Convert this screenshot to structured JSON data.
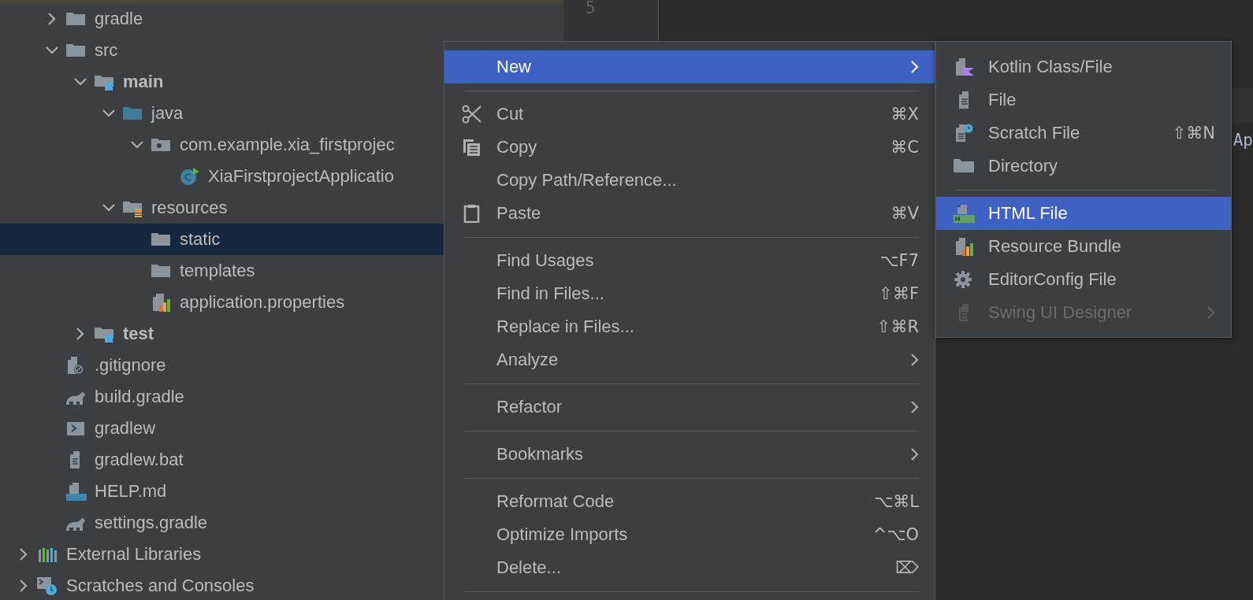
{
  "project_tree": {
    "project_items": [
      {
        "label": "gradle",
        "kind": "folder",
        "expanded": false,
        "selected": false
      },
      {
        "label": "src",
        "kind": "folder",
        "expanded": true,
        "selected": false,
        "children": [
          {
            "label": "main",
            "kind": "source-root",
            "expanded": true,
            "selected": false,
            "children": [
              {
                "label": "java",
                "kind": "java-root",
                "expanded": true,
                "selected": false,
                "children": [
                  {
                    "label": "com.example.xia_firstprojec",
                    "kind": "package",
                    "expanded": true,
                    "selected": false,
                    "children": [
                      {
                        "label": "XiaFirstprojectApplicatio",
                        "kind": "spring-class",
                        "selected": false
                      }
                    ]
                  }
                ]
              },
              {
                "label": "resources",
                "kind": "resources-root",
                "expanded": true,
                "selected": false,
                "children": [
                  {
                    "label": "static",
                    "kind": "folder",
                    "selected": true
                  },
                  {
                    "label": "templates",
                    "kind": "folder",
                    "selected": false
                  },
                  {
                    "label": "application.properties",
                    "kind": "properties",
                    "selected": false
                  }
                ]
              }
            ]
          },
          {
            "label": "test",
            "kind": "source-root",
            "expanded": false,
            "selected": false
          }
        ]
      },
      {
        "label": ".gitignore",
        "kind": "ignore-file",
        "selected": false
      },
      {
        "label": "build.gradle",
        "kind": "gradle",
        "selected": false
      },
      {
        "label": "gradlew",
        "kind": "script",
        "selected": false
      },
      {
        "label": "gradlew.bat",
        "kind": "text-file",
        "selected": false
      },
      {
        "label": "HELP.md",
        "kind": "markdown",
        "selected": false
      },
      {
        "label": "settings.gradle",
        "kind": "gradle",
        "selected": false
      }
    ],
    "top_items": [
      {
        "label": "External Libraries",
        "kind": "libraries",
        "expanded": false,
        "selected": false
      },
      {
        "label": "Scratches and Consoles",
        "kind": "scratches",
        "expanded": false,
        "selected": false
      }
    ]
  },
  "editor": {
    "lines": [
      {
        "number": "5"
      }
    ],
    "cut_line": "Ap"
  },
  "context_menu": {
    "items": [
      {
        "kind": "item",
        "label": "New",
        "selected": true,
        "has_submenu": true
      },
      {
        "kind": "separator"
      },
      {
        "kind": "item",
        "label": "Cut",
        "shortcut": "⌘X",
        "selected": false,
        "has_submenu": false
      },
      {
        "kind": "item",
        "label": "Copy",
        "shortcut": "⌘C",
        "selected": false,
        "has_submenu": false
      },
      {
        "kind": "item",
        "label": "Copy Path/Reference...",
        "selected": false,
        "has_submenu": false
      },
      {
        "kind": "item",
        "label": "Paste",
        "shortcut": "⌘V",
        "selected": false,
        "has_submenu": false
      },
      {
        "kind": "separator"
      },
      {
        "kind": "item",
        "label": "Find Usages",
        "shortcut": "⌥F7",
        "selected": false,
        "has_submenu": false
      },
      {
        "kind": "item",
        "label": "Find in Files...",
        "shortcut": "⇧⌘F",
        "selected": false,
        "has_submenu": false
      },
      {
        "kind": "item",
        "label": "Replace in Files...",
        "shortcut": "⇧⌘R",
        "selected": false,
        "has_submenu": false
      },
      {
        "kind": "item",
        "label": "Analyze",
        "selected": false,
        "has_submenu": true
      },
      {
        "kind": "separator"
      },
      {
        "kind": "item",
        "label": "Refactor",
        "selected": false,
        "has_submenu": true
      },
      {
        "kind": "separator"
      },
      {
        "kind": "item",
        "label": "Bookmarks",
        "selected": false,
        "has_submenu": true
      },
      {
        "kind": "separator"
      },
      {
        "kind": "item",
        "label": "Reformat Code",
        "shortcut": "⌥⌘L",
        "selected": false,
        "has_submenu": false
      },
      {
        "kind": "item",
        "label": "Optimize Imports",
        "shortcut": "^⌥O",
        "selected": false,
        "has_submenu": false
      },
      {
        "kind": "item",
        "label": "Delete...",
        "shortcut": "⌦",
        "selected": false,
        "has_submenu": false
      },
      {
        "kind": "separator"
      }
    ]
  },
  "new_submenu": {
    "items": [
      {
        "kind": "item",
        "label": "Kotlin Class/File",
        "selected": false,
        "disabled": false,
        "has_submenu": false
      },
      {
        "kind": "item",
        "label": "File",
        "selected": false,
        "disabled": false,
        "has_submenu": false
      },
      {
        "kind": "item",
        "label": "Scratch File",
        "shortcut": "⇧⌘N",
        "selected": false,
        "disabled": false,
        "has_submenu": false
      },
      {
        "kind": "item",
        "label": "Directory",
        "selected": false,
        "disabled": false,
        "has_submenu": false
      },
      {
        "kind": "separator"
      },
      {
        "kind": "item",
        "label": "HTML File",
        "selected": true,
        "disabled": false,
        "has_submenu": false
      },
      {
        "kind": "item",
        "label": "Resource Bundle",
        "selected": false,
        "disabled": false,
        "has_submenu": false
      },
      {
        "kind": "item",
        "label": "EditorConfig File",
        "selected": false,
        "disabled": false,
        "has_submenu": false
      },
      {
        "kind": "item",
        "label": "Swing UI Designer",
        "selected": false,
        "disabled": true,
        "has_submenu": true
      }
    ]
  }
}
